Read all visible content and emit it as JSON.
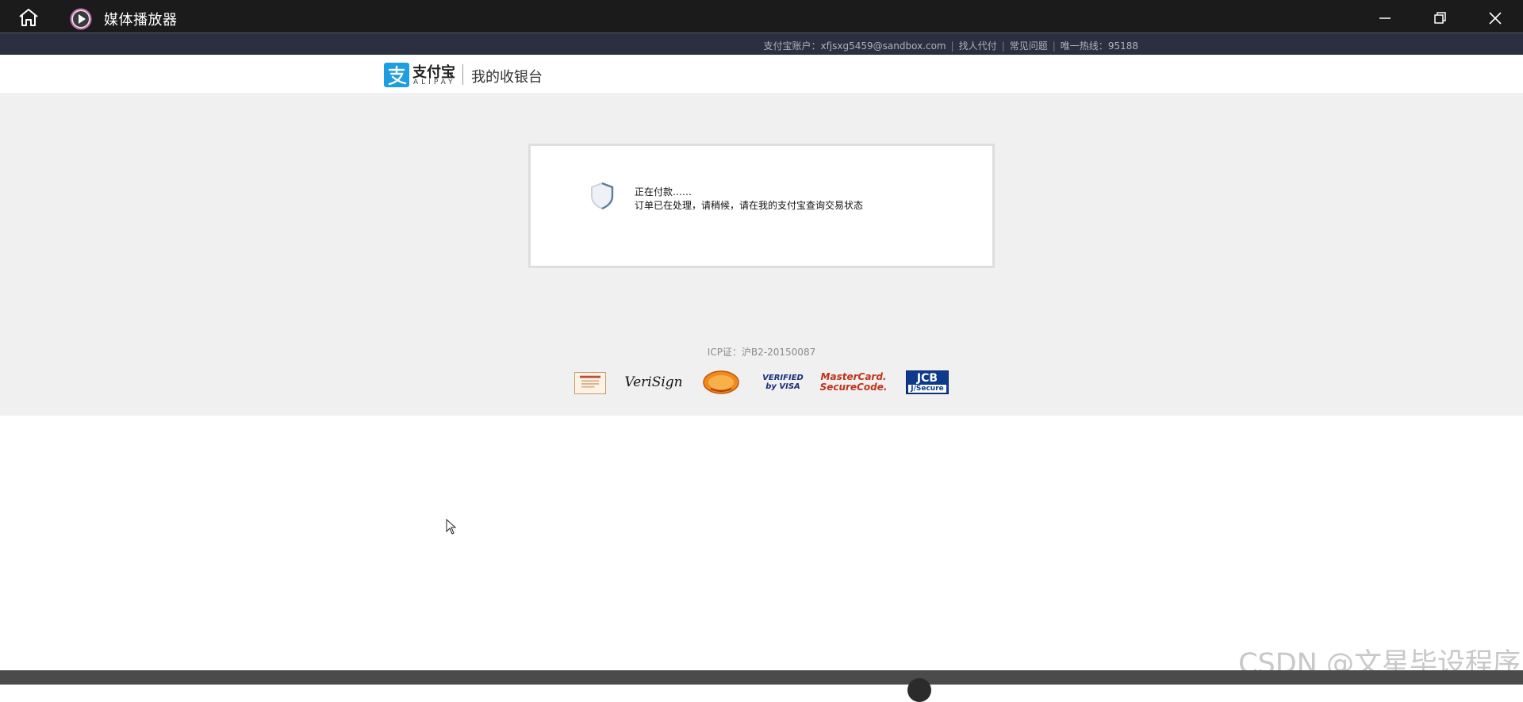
{
  "window": {
    "title": "媒体播放器",
    "colors": {
      "titlebar": "#1b1b1b",
      "topbar": "#2a3040"
    }
  },
  "topbar": {
    "account_label": "支付宝账户：",
    "account": "xfjsxg5459@sandbox.com",
    "pay_for_others": "找人代付",
    "faq": "常见问题",
    "hotline_label": "唯一热线：",
    "hotline": "95188"
  },
  "header": {
    "logo_text": "支付宝",
    "logo_sub": "ALIPAY",
    "cashier_title": "我的收银台"
  },
  "status_card": {
    "icon": "shield-icon",
    "line1": "正在付款……",
    "line2": "订单已在处理，请稍候，请在我的支付宝查询交易状态"
  },
  "footer": {
    "icp": "ICP证：沪B2-20150087",
    "badges": {
      "verisign": "VeriSign",
      "visa_line1": "VERIFIED",
      "visa_line2": "by VISA",
      "mc_line1": "MasterCard.",
      "mc_line2": "SecureCode.",
      "jcb_line1": "JCB",
      "jcb_line2": "J/Secure"
    }
  },
  "watermark": "CSDN @文星毕设程序"
}
